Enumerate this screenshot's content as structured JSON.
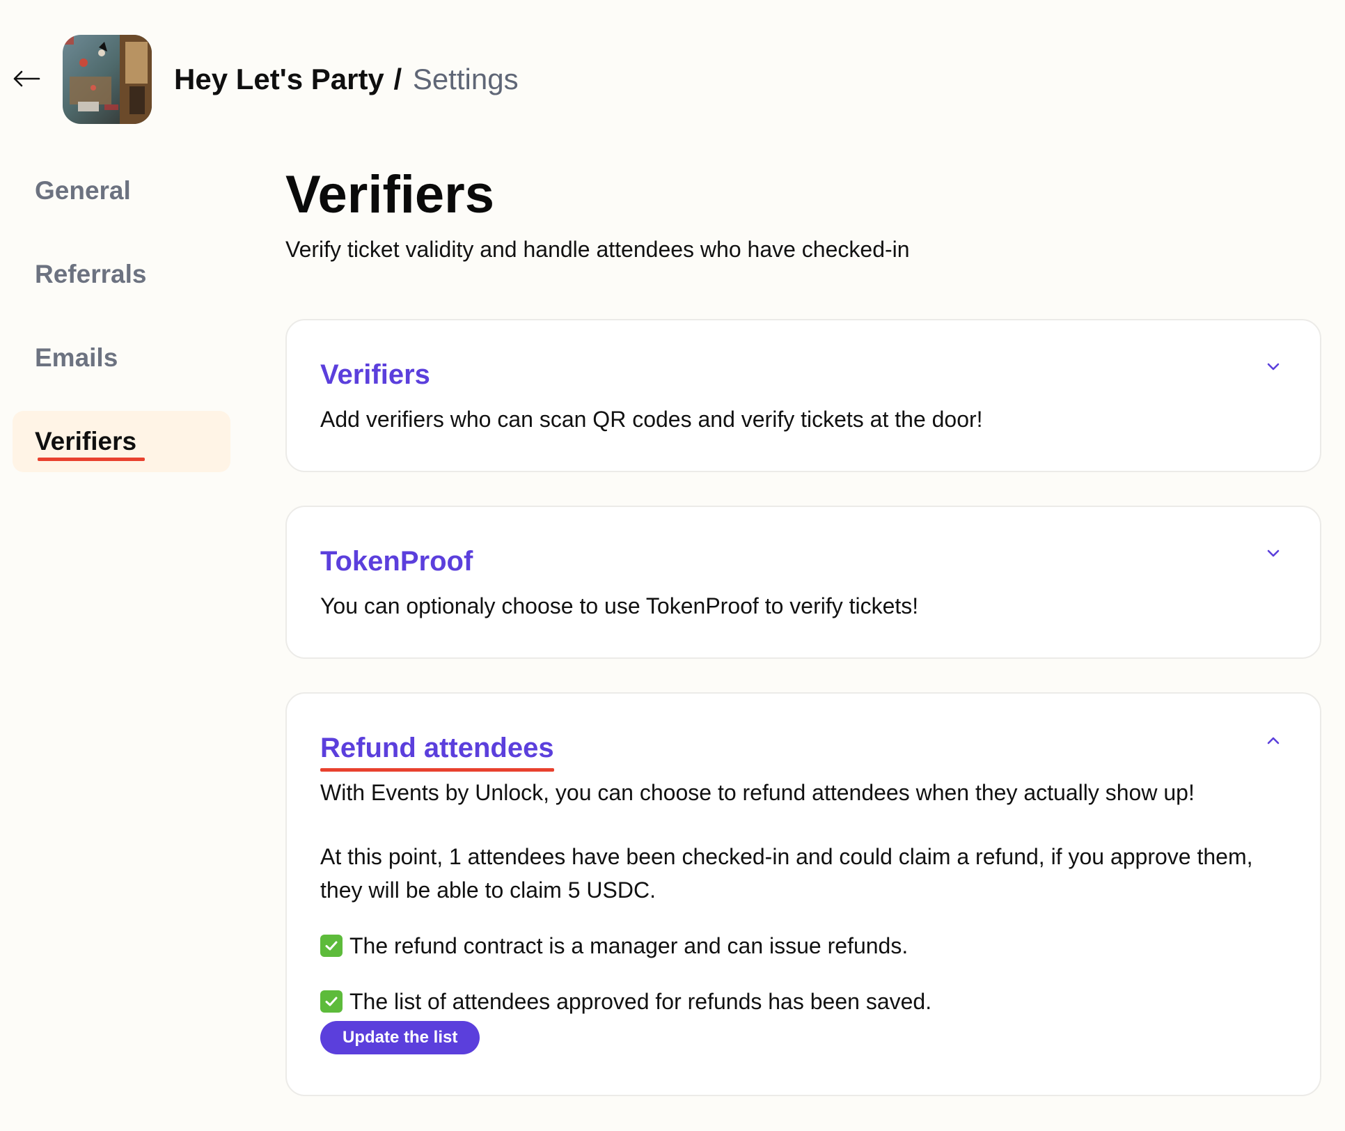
{
  "header": {
    "back_icon": "arrow-left-icon",
    "event_name": "Hey Let's Party",
    "separator": "/",
    "page": "Settings"
  },
  "sidebar": {
    "items": [
      {
        "label": "General",
        "active": false
      },
      {
        "label": "Referrals",
        "active": false
      },
      {
        "label": "Emails",
        "active": false
      },
      {
        "label": "Verifiers",
        "active": true
      }
    ]
  },
  "main": {
    "title": "Verifiers",
    "subtitle": "Verify ticket validity and handle attendees who have checked-in",
    "cards": [
      {
        "title": "Verifiers",
        "description": "Add verifiers who can scan QR codes and verify tickets at the door!",
        "expanded": false,
        "chevron_icon": "chevron-down-icon"
      },
      {
        "title": "TokenProof",
        "description": "You can optionaly choose to use TokenProof to verify tickets!",
        "expanded": false,
        "chevron_icon": "chevron-down-icon"
      },
      {
        "title": "Refund attendees",
        "description": "With Events by Unlock, you can choose to refund attendees when they actually show up!",
        "expanded": true,
        "chevron_icon": "chevron-up-icon",
        "body": {
          "paragraph": "At this point, 1 attendees have been checked-in and could claim a refund, if you approve them, they will be able to claim 5 USDC.",
          "check_1": "The refund contract is a manager and can issue refunds.",
          "check_2": "The list of attendees approved for refunds has been saved.",
          "button_label": "Update the list"
        }
      }
    ]
  },
  "colors": {
    "accent": "#5b3fdc",
    "underline": "#e8412e",
    "active_nav_bg": "#fff4e6",
    "check_green": "#5dbb3b",
    "page_bg": "#fdfcf8"
  }
}
